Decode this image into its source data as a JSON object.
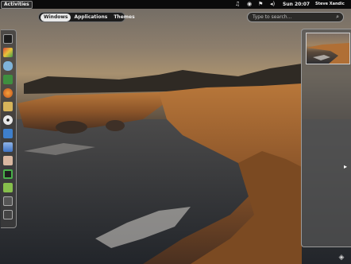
{
  "panel": {
    "activities_label": "Activities",
    "clock": "Sun 20:07",
    "user_name": "Steve Xandic",
    "status_icons": [
      "music-icon",
      "accessibility-icon",
      "network-icon",
      "volume-icon"
    ]
  },
  "overview": {
    "tabs": [
      {
        "label": "Windows",
        "active": true
      },
      {
        "label": "Applications",
        "active": false
      },
      {
        "label": "Themes",
        "active": false
      }
    ],
    "search": {
      "placeholder": "Type to search...",
      "value": ""
    }
  },
  "dash": {
    "apps": [
      {
        "name": "terminal",
        "color": "#2a2a2a"
      },
      {
        "name": "chromium",
        "color": "#4a7cc8"
      },
      {
        "name": "chat",
        "color": "#6aa0c8"
      },
      {
        "name": "network",
        "color": "#3d8e3d"
      },
      {
        "name": "firefox",
        "color": "#d07026"
      },
      {
        "name": "file-manager",
        "color": "#c9a24a"
      },
      {
        "name": "disc-player",
        "color": "#e6e6e6"
      },
      {
        "name": "software-center",
        "color": "#4c86c9"
      },
      {
        "name": "text-document",
        "color": "#5b8fd0"
      },
      {
        "name": "notes",
        "color": "#b98a6c"
      },
      {
        "name": "system-monitor",
        "color": "#3fa23f"
      },
      {
        "name": "calendar",
        "color": "#7bb04a"
      },
      {
        "name": "settings",
        "color": "#6b6b6b"
      },
      {
        "name": "display",
        "color": "#6b6b6b"
      }
    ]
  },
  "workspaces": {
    "count": 1
  }
}
